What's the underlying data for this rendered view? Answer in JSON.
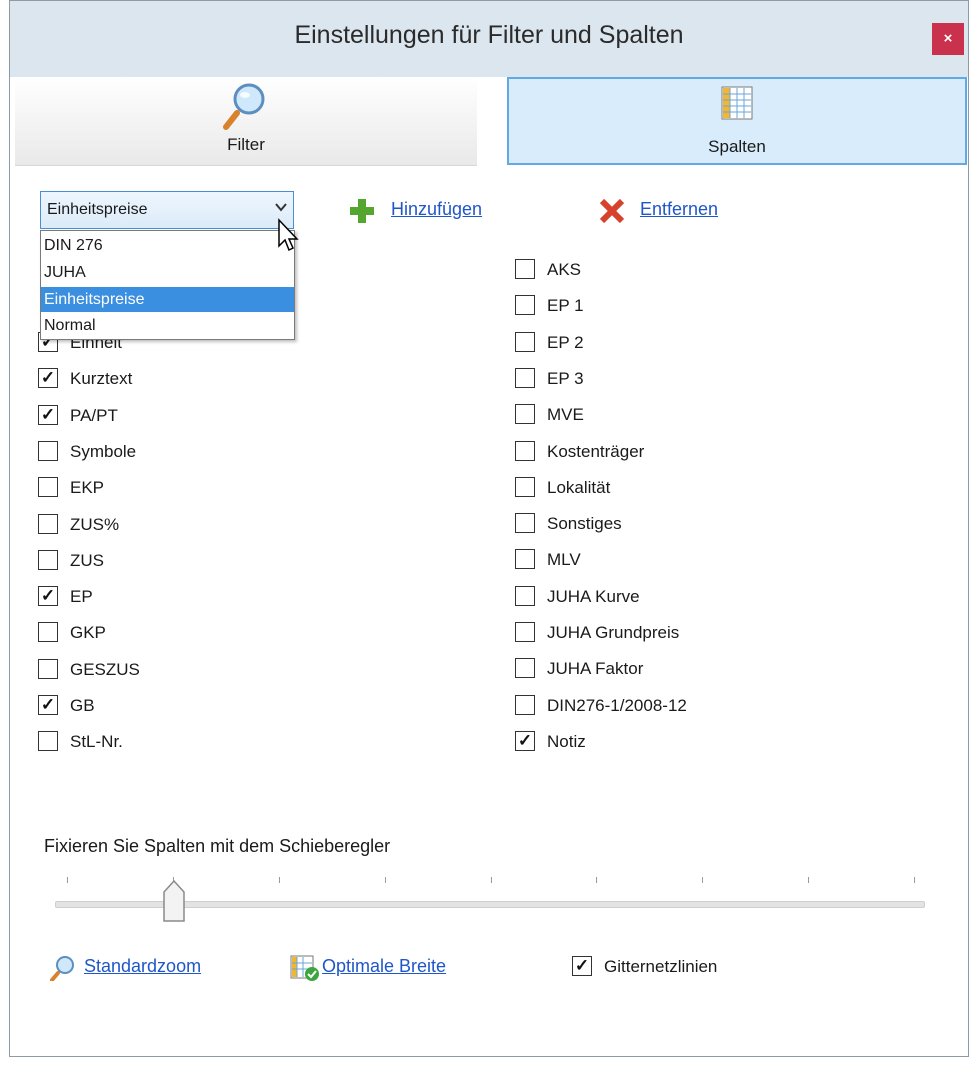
{
  "window": {
    "title": "Einstellungen für Filter und Spalten",
    "close_label": "×"
  },
  "tabs": [
    {
      "label": "Filter"
    },
    {
      "label": "Spalten"
    }
  ],
  "toolbar": {
    "combo_value": "Einheitspreise",
    "add_label": "Hinzufügen",
    "remove_label": "Entfernen",
    "dropdown_options": [
      "DIN 276",
      "JUHA",
      "Einheitspreise",
      "Normal"
    ],
    "dropdown_selected": "Einheitspreise"
  },
  "columns_left": [
    {
      "label": "Einheit",
      "checked": true
    },
    {
      "label": "Kurztext",
      "checked": true
    },
    {
      "label": "PA/PT",
      "checked": true
    },
    {
      "label": "Symbole",
      "checked": false
    },
    {
      "label": "EKP",
      "checked": false
    },
    {
      "label": "ZUS%",
      "checked": false
    },
    {
      "label": "ZUS",
      "checked": false
    },
    {
      "label": "EP",
      "checked": true
    },
    {
      "label": "GKP",
      "checked": false
    },
    {
      "label": "GESZUS",
      "checked": false
    },
    {
      "label": "GB",
      "checked": true
    },
    {
      "label": "StL-Nr.",
      "checked": false
    }
  ],
  "columns_right": [
    {
      "label": "AKS",
      "checked": false
    },
    {
      "label": "EP 1",
      "checked": false
    },
    {
      "label": "EP 2",
      "checked": false
    },
    {
      "label": "EP 3",
      "checked": false
    },
    {
      "label": "MVE",
      "checked": false
    },
    {
      "label": "Kostenträger",
      "checked": false
    },
    {
      "label": "Lokalität",
      "checked": false
    },
    {
      "label": "Sonstiges",
      "checked": false
    },
    {
      "label": "MLV",
      "checked": false
    },
    {
      "label": "JUHA Kurve",
      "checked": false
    },
    {
      "label": "JUHA Grundpreis",
      "checked": false
    },
    {
      "label": "JUHA Faktor",
      "checked": false
    },
    {
      "label": "DIN276-1/2008-12",
      "checked": false
    },
    {
      "label": "Notiz",
      "checked": true
    }
  ],
  "slider": {
    "label": "Fixieren Sie Spalten mit dem Schieberegler",
    "tick_count": 9,
    "value_index": 1
  },
  "footer": {
    "zoom_label": "Standardzoom",
    "width_label": "Optimale Breite",
    "grid_label": "Gitternetzlinien",
    "grid_checked": true
  },
  "colors": {
    "accent": "#3b8fe0",
    "link": "#1f56c9",
    "close_bg": "#c9314d",
    "tab_selected_bg": "#d8ecfb"
  }
}
